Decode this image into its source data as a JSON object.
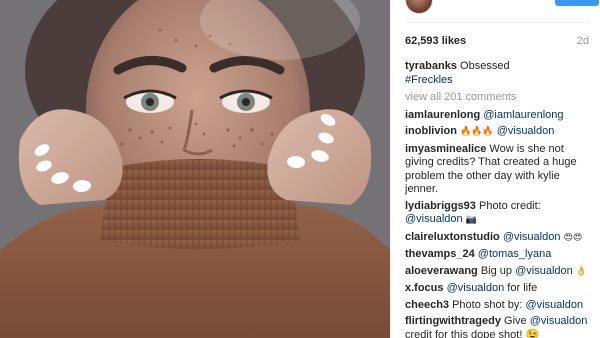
{
  "photo": {
    "alt_visible": ""
  },
  "header": {
    "username": ""
  },
  "stats": {
    "likes": "62,593 likes",
    "time": "2d"
  },
  "caption": {
    "user": "tyrabanks",
    "text": "Obsessed",
    "hashtag": "#Freckles"
  },
  "view_all": "view all 201 comments",
  "comments": [
    {
      "user": "iamlaurenlong",
      "text": "@iamlaurenlong",
      "text_is_tag": true
    },
    {
      "user": "inoblivion",
      "text_pre": "🔥🔥🔥",
      "tag": "@visualdon"
    },
    {
      "user": "imyasminealice",
      "text": "Wow is she not giving credits? That created a huge problem the other day with kylie jenner."
    },
    {
      "user": "lydiabriggs93",
      "text_pre": "Photo credit:",
      "tag": "@visualdon",
      "text_post": "📷"
    },
    {
      "user": "claireluxtonstudio",
      "tag": "@visualdon",
      "text_post": "😍😍"
    },
    {
      "user": "thevamps_24",
      "tag": "@tomas_lyana"
    },
    {
      "user": "aloeverawang",
      "text_pre": "Big up",
      "tag": "@visualdon",
      "text_post": "👌"
    },
    {
      "user": "x.focus",
      "tag": "@visualdon",
      "text_post": "for life"
    },
    {
      "user": "cheech3",
      "text_pre": "Photo shot by:",
      "tag": "@visualdon"
    },
    {
      "user": "flirtingwithtragedy",
      "text_pre": "Give",
      "tag": "@visualdon",
      "text_post": "credit for this dope shot! 😉"
    }
  ],
  "colors": {
    "accent": "#3897f0",
    "link": "#003569",
    "muted": "#999999",
    "text": "#262626"
  }
}
